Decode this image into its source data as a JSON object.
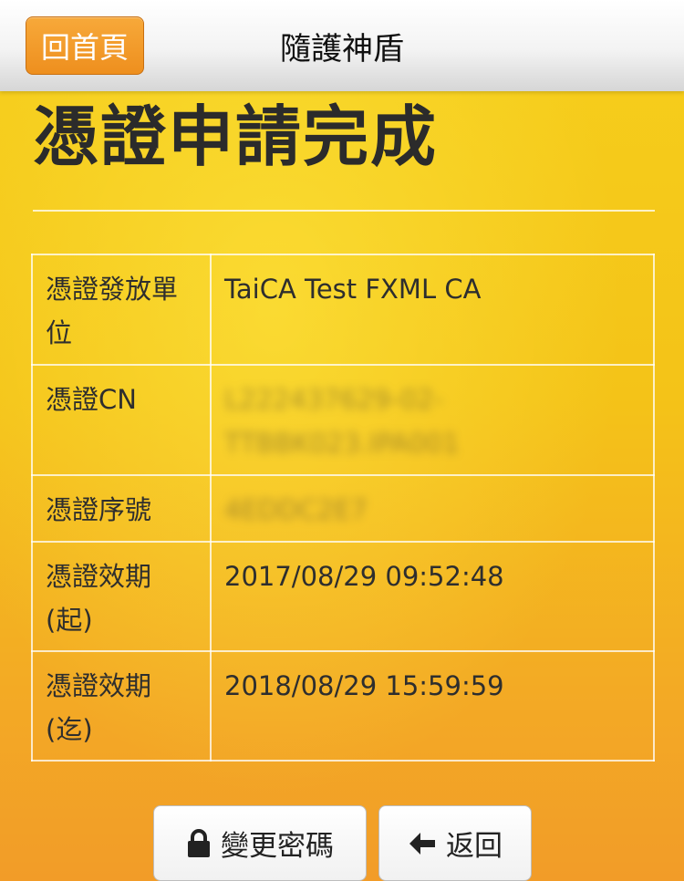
{
  "header": {
    "home_label": "回首頁",
    "app_title": "隨護神盾"
  },
  "page": {
    "title": "憑證申請完成"
  },
  "details": {
    "rows": [
      {
        "label": "憑證發放單位",
        "value": "TaiCA Test FXML CA"
      },
      {
        "label": "憑證CN",
        "value": "L222437629-02-TTBBK023.IPA001"
      },
      {
        "label": "憑證序號",
        "value": "4EDDC2E7"
      },
      {
        "label": "憑證效期(起)",
        "value": "2017/08/29 09:52:48"
      },
      {
        "label": "憑證效期(迄)",
        "value": "2018/08/29 15:59:59"
      }
    ]
  },
  "actions": {
    "change_password_label": "變更密碼",
    "change_password_icon": "lock-icon",
    "back_label": "返回",
    "back_icon": "arrow-left-icon"
  },
  "colors": {
    "background_top": "#f6cf1c",
    "background_bottom": "#f29c28",
    "home_button": "#ee8f1e",
    "text_dark": "#2b2b2b"
  }
}
